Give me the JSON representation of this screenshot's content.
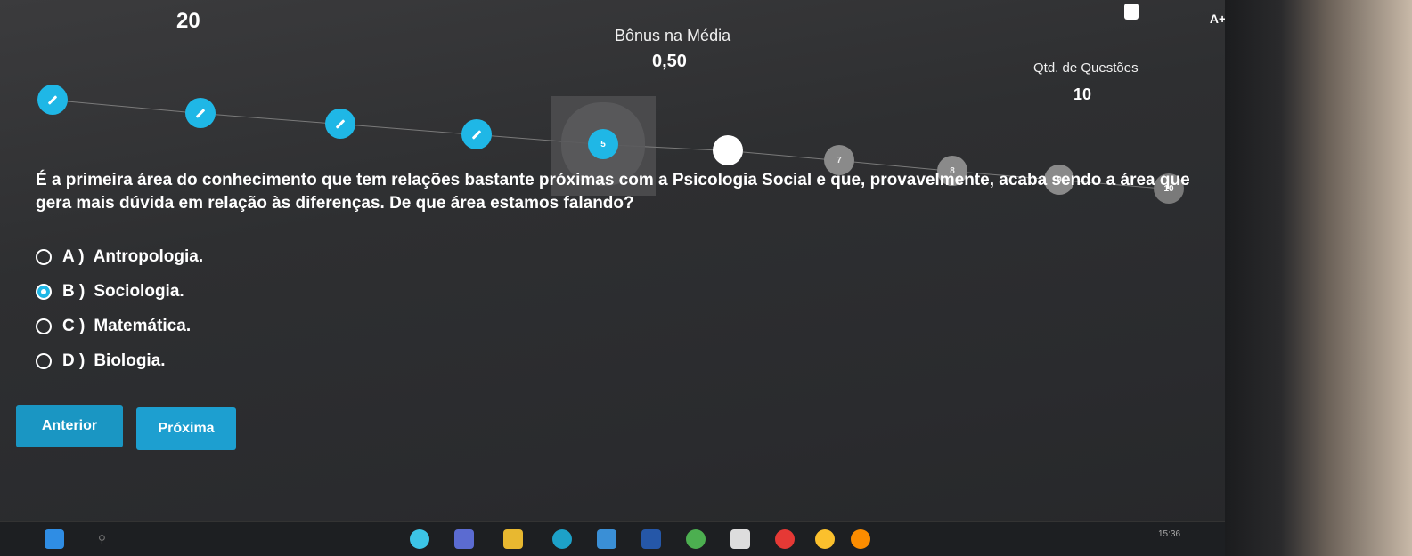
{
  "header": {
    "top_number": "20",
    "bonus_label": "Bônus na Média",
    "bonus_value": "0,50",
    "qtd_label": "Qtd. de Questões",
    "qtd_value": "10",
    "font_button": "A+"
  },
  "stepper": {
    "steps": [
      {
        "state": "done",
        "label": ""
      },
      {
        "state": "done",
        "label": ""
      },
      {
        "state": "done",
        "label": ""
      },
      {
        "state": "done",
        "label": ""
      },
      {
        "state": "current",
        "label": "5"
      },
      {
        "state": "white",
        "label": ""
      },
      {
        "state": "gray",
        "label": "7"
      },
      {
        "state": "gray",
        "label": "8"
      },
      {
        "state": "gray",
        "label": "9"
      },
      {
        "state": "last",
        "label": "10"
      }
    ]
  },
  "question": {
    "text": "É a primeira área do conhecimento que tem relações bastante próximas com a Psicologia Social e que, provavelmente, acaba sendo a área que gera mais dúvida em relação às diferenças. De que área estamos falando?"
  },
  "options": [
    {
      "letter": "A )",
      "text": "Antropologia.",
      "selected": false
    },
    {
      "letter": "B )",
      "text": "Sociologia.",
      "selected": true
    },
    {
      "letter": "C )",
      "text": "Matemática.",
      "selected": false
    },
    {
      "letter": "D )",
      "text": "Biologia.",
      "selected": false
    }
  ],
  "buttons": {
    "prev": "Anterior",
    "next": "Próxima"
  },
  "taskbar": {
    "clock": "15:36"
  },
  "colors": {
    "accent": "#1fb7e6",
    "button": "#1a96c3"
  }
}
